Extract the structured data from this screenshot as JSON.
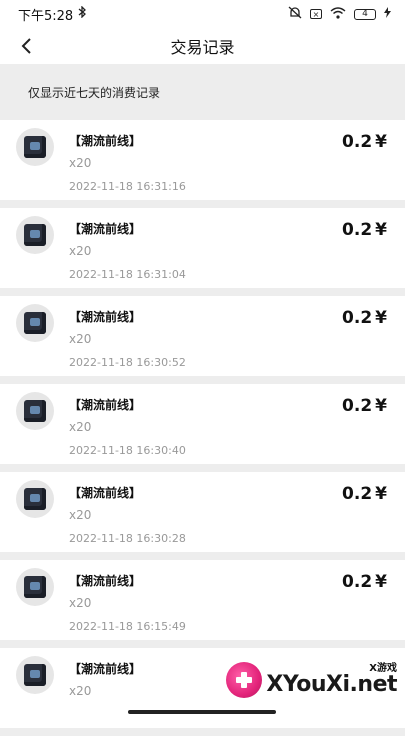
{
  "status_bar": {
    "time": "下午5:28",
    "battery": "4"
  },
  "nav": {
    "title": "交易记录"
  },
  "notice": "仅显示近七天的消费记录",
  "records": [
    {
      "name": "【潮流前线】",
      "qty": "x20",
      "date": "2022-11-18 16:31:16",
      "price": "0.2",
      "currency": "¥"
    },
    {
      "name": "【潮流前线】",
      "qty": "x20",
      "date": "2022-11-18 16:31:04",
      "price": "0.2",
      "currency": "¥"
    },
    {
      "name": "【潮流前线】",
      "qty": "x20",
      "date": "2022-11-18 16:30:52",
      "price": "0.2",
      "currency": "¥"
    },
    {
      "name": "【潮流前线】",
      "qty": "x20",
      "date": "2022-11-18 16:30:40",
      "price": "0.2",
      "currency": "¥"
    },
    {
      "name": "【潮流前线】",
      "qty": "x20",
      "date": "2022-11-18 16:30:28",
      "price": "0.2",
      "currency": "¥"
    },
    {
      "name": "【潮流前线】",
      "qty": "x20",
      "date": "2022-11-18 16:15:49",
      "price": "0.2",
      "currency": "¥"
    },
    {
      "name": "【潮流前线】",
      "qty": "x20",
      "date": "",
      "price": "",
      "currency": ""
    }
  ],
  "watermark": {
    "small": "X游戏",
    "big": "XYouXi.net"
  },
  "icons": {
    "back": "chevron-left-icon",
    "bluetooth": "bluetooth-icon",
    "mute": "alarm-off-icon",
    "wifi": "wifi-icon",
    "sim": "sim-icon",
    "battery": "battery-icon",
    "product": "gift-box-icon"
  }
}
